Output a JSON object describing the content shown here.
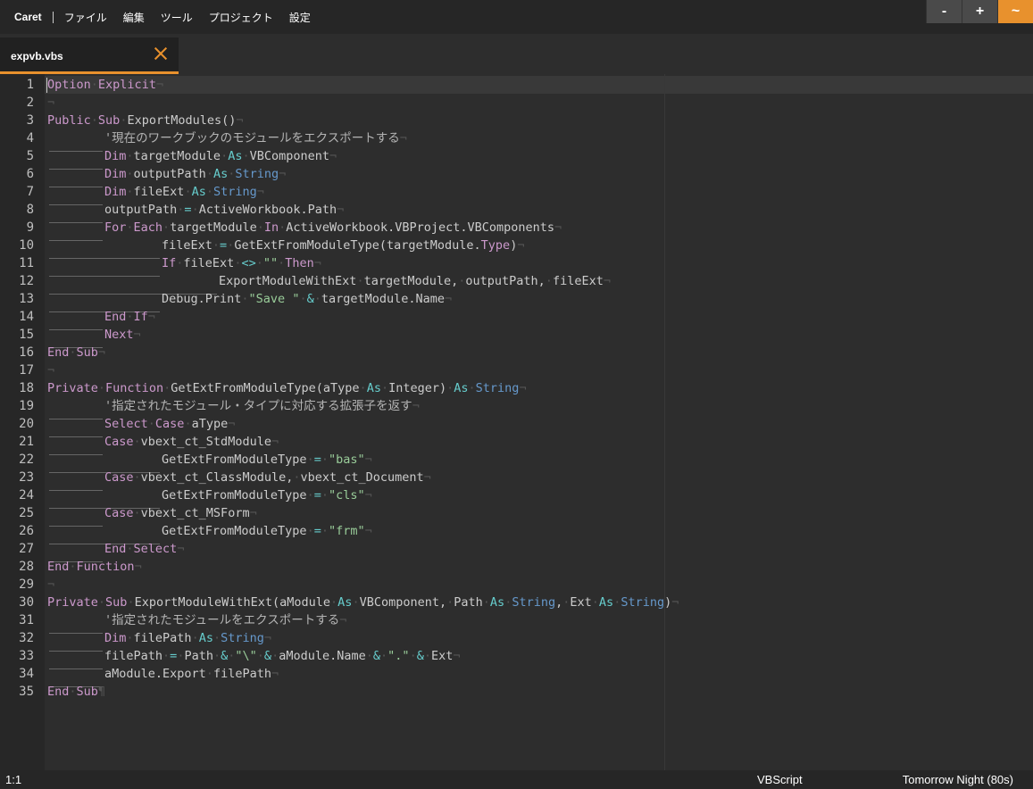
{
  "app": {
    "name": "Caret"
  },
  "menu": [
    "ファイル",
    "編集",
    "ツール",
    "プロジェクト",
    "設定"
  ],
  "window_controls": [
    "-",
    "+",
    "~"
  ],
  "tab": {
    "title": "expvb.vbs"
  },
  "colors": {
    "accent": "#e8912d",
    "background": "#2d2d2d",
    "keyword": "#cc99cc",
    "type": "#6699cc",
    "string": "#99cc99",
    "operator": "#66cccc"
  },
  "editor": {
    "lines": [
      [
        {
          "t": "Option",
          "c": "kw"
        },
        {
          "t": "·",
          "c": "eol"
        },
        {
          "t": "Explicit",
          "c": "kw"
        },
        {
          "t": "¬",
          "c": "eol"
        }
      ],
      [
        {
          "t": "¬",
          "c": "eol"
        }
      ],
      [
        {
          "t": "Public",
          "c": "kw"
        },
        {
          "t": "·",
          "c": "eol"
        },
        {
          "t": "Sub",
          "c": "kw"
        },
        {
          "t": "·",
          "c": "eol"
        },
        {
          "t": "ExportModules()"
        },
        {
          "t": "¬",
          "c": "eol"
        }
      ],
      [
        {
          "i": 1
        },
        {
          "t": "'現在のワークブックのモジュールをエクスポートする",
          "c": "cm"
        },
        {
          "t": "¬",
          "c": "eol"
        }
      ],
      [
        {
          "i": 1
        },
        {
          "t": "Dim",
          "c": "kw"
        },
        {
          "t": "·",
          "c": "eol"
        },
        {
          "t": "targetModule"
        },
        {
          "t": "·",
          "c": "eol"
        },
        {
          "t": "As",
          "c": "op"
        },
        {
          "t": "·",
          "c": "eol"
        },
        {
          "t": "VBComponent"
        },
        {
          "t": "¬",
          "c": "eol"
        }
      ],
      [
        {
          "i": 1
        },
        {
          "t": "Dim",
          "c": "kw"
        },
        {
          "t": "·",
          "c": "eol"
        },
        {
          "t": "outputPath"
        },
        {
          "t": "·",
          "c": "eol"
        },
        {
          "t": "As",
          "c": "op"
        },
        {
          "t": "·",
          "c": "eol"
        },
        {
          "t": "String",
          "c": "ty"
        },
        {
          "t": "¬",
          "c": "eol"
        }
      ],
      [
        {
          "i": 1
        },
        {
          "t": "Dim",
          "c": "kw"
        },
        {
          "t": "·",
          "c": "eol"
        },
        {
          "t": "fileExt"
        },
        {
          "t": "·",
          "c": "eol"
        },
        {
          "t": "As",
          "c": "op"
        },
        {
          "t": "·",
          "c": "eol"
        },
        {
          "t": "String",
          "c": "ty"
        },
        {
          "t": "¬",
          "c": "eol"
        }
      ],
      [
        {
          "i": 1
        },
        {
          "t": "outputPath"
        },
        {
          "t": "·",
          "c": "eol"
        },
        {
          "t": "=",
          "c": "op"
        },
        {
          "t": "·",
          "c": "eol"
        },
        {
          "t": "ActiveWorkbook.Path"
        },
        {
          "t": "¬",
          "c": "eol"
        }
      ],
      [
        {
          "i": 1
        },
        {
          "t": "For",
          "c": "kw"
        },
        {
          "t": "·",
          "c": "eol"
        },
        {
          "t": "Each",
          "c": "kw"
        },
        {
          "t": "·",
          "c": "eol"
        },
        {
          "t": "targetModule"
        },
        {
          "t": "·",
          "c": "eol"
        },
        {
          "t": "In",
          "c": "kw"
        },
        {
          "t": "·",
          "c": "eol"
        },
        {
          "t": "ActiveWorkbook.VBProject.VBComponents"
        },
        {
          "t": "¬",
          "c": "eol"
        }
      ],
      [
        {
          "i": 2
        },
        {
          "t": "fileExt"
        },
        {
          "t": "·",
          "c": "eol"
        },
        {
          "t": "=",
          "c": "op"
        },
        {
          "t": "·",
          "c": "eol"
        },
        {
          "t": "GetExtFromModuleType(targetModule."
        },
        {
          "t": "Type",
          "c": "kw"
        },
        {
          "t": ")"
        },
        {
          "t": "¬",
          "c": "eol"
        }
      ],
      [
        {
          "i": 2
        },
        {
          "t": "If",
          "c": "kw"
        },
        {
          "t": "·",
          "c": "eol"
        },
        {
          "t": "fileExt"
        },
        {
          "t": "·",
          "c": "eol"
        },
        {
          "t": "<>",
          "c": "op"
        },
        {
          "t": "·",
          "c": "eol"
        },
        {
          "t": "\"\"",
          "c": "str"
        },
        {
          "t": "·",
          "c": "eol"
        },
        {
          "t": "Then",
          "c": "kw"
        },
        {
          "t": "¬",
          "c": "eol"
        }
      ],
      [
        {
          "i": 3
        },
        {
          "t": "ExportModuleWithExt"
        },
        {
          "t": "·",
          "c": "eol"
        },
        {
          "t": "targetModule,"
        },
        {
          "t": "·",
          "c": "eol"
        },
        {
          "t": "outputPath,"
        },
        {
          "t": "·",
          "c": "eol"
        },
        {
          "t": "fileExt"
        },
        {
          "t": "¬",
          "c": "eol"
        }
      ],
      [
        {
          "i": 2
        },
        {
          "t": "Debug.Print"
        },
        {
          "t": "·",
          "c": "eol"
        },
        {
          "t": "\"Save \"",
          "c": "str"
        },
        {
          "t": "·",
          "c": "eol"
        },
        {
          "t": "&",
          "c": "op"
        },
        {
          "t": "·",
          "c": "eol"
        },
        {
          "t": "targetModule.Name"
        },
        {
          "t": "¬",
          "c": "eol"
        }
      ],
      [
        {
          "i": 1
        },
        {
          "t": "End",
          "c": "kw"
        },
        {
          "t": "·",
          "c": "eol"
        },
        {
          "t": "If",
          "c": "kw"
        },
        {
          "t": "¬",
          "c": "eol"
        }
      ],
      [
        {
          "i": 1
        },
        {
          "t": "Next",
          "c": "kw"
        },
        {
          "t": "¬",
          "c": "eol"
        }
      ],
      [
        {
          "t": "End",
          "c": "kw"
        },
        {
          "t": "·",
          "c": "eol"
        },
        {
          "t": "Sub",
          "c": "kw"
        },
        {
          "t": "¬",
          "c": "eol"
        }
      ],
      [
        {
          "t": "¬",
          "c": "eol"
        }
      ],
      [
        {
          "t": "Private",
          "c": "kw"
        },
        {
          "t": "·",
          "c": "eol"
        },
        {
          "t": "Function",
          "c": "kw"
        },
        {
          "t": "·",
          "c": "eol"
        },
        {
          "t": "GetExtFromModuleType(aType"
        },
        {
          "t": "·",
          "c": "eol"
        },
        {
          "t": "As",
          "c": "op"
        },
        {
          "t": "·",
          "c": "eol"
        },
        {
          "t": "Integer)"
        },
        {
          "t": "·",
          "c": "eol"
        },
        {
          "t": "As",
          "c": "op"
        },
        {
          "t": "·",
          "c": "eol"
        },
        {
          "t": "String",
          "c": "ty"
        },
        {
          "t": "¬",
          "c": "eol"
        }
      ],
      [
        {
          "i": 1
        },
        {
          "t": "'指定されたモジュール・タイプに対応する拡張子を返す",
          "c": "cm"
        },
        {
          "t": "¬",
          "c": "eol"
        }
      ],
      [
        {
          "i": 1
        },
        {
          "t": "Select",
          "c": "kw"
        },
        {
          "t": "·",
          "c": "eol"
        },
        {
          "t": "Case",
          "c": "kw"
        },
        {
          "t": "·",
          "c": "eol"
        },
        {
          "t": "aType"
        },
        {
          "t": "¬",
          "c": "eol"
        }
      ],
      [
        {
          "i": 1
        },
        {
          "t": "Case",
          "c": "kw"
        },
        {
          "t": "·",
          "c": "eol"
        },
        {
          "t": "vbext_ct_StdModule"
        },
        {
          "t": "¬",
          "c": "eol"
        }
      ],
      [
        {
          "i": 2
        },
        {
          "t": "GetExtFromModuleType"
        },
        {
          "t": "·",
          "c": "eol"
        },
        {
          "t": "=",
          "c": "op"
        },
        {
          "t": "·",
          "c": "eol"
        },
        {
          "t": "\"bas\"",
          "c": "str"
        },
        {
          "t": "¬",
          "c": "eol"
        }
      ],
      [
        {
          "i": 1
        },
        {
          "t": "Case",
          "c": "kw"
        },
        {
          "t": "·",
          "c": "eol"
        },
        {
          "t": "vbext_ct_ClassModule,"
        },
        {
          "t": "·",
          "c": "eol"
        },
        {
          "t": "vbext_ct_Document"
        },
        {
          "t": "¬",
          "c": "eol"
        }
      ],
      [
        {
          "i": 2
        },
        {
          "t": "GetExtFromModuleType"
        },
        {
          "t": "·",
          "c": "eol"
        },
        {
          "t": "=",
          "c": "op"
        },
        {
          "t": "·",
          "c": "eol"
        },
        {
          "t": "\"cls\"",
          "c": "str"
        },
        {
          "t": "¬",
          "c": "eol"
        }
      ],
      [
        {
          "i": 1
        },
        {
          "t": "Case",
          "c": "kw"
        },
        {
          "t": "·",
          "c": "eol"
        },
        {
          "t": "vbext_ct_MSForm"
        },
        {
          "t": "¬",
          "c": "eol"
        }
      ],
      [
        {
          "i": 2
        },
        {
          "t": "GetExtFromModuleType"
        },
        {
          "t": "·",
          "c": "eol"
        },
        {
          "t": "=",
          "c": "op"
        },
        {
          "t": "·",
          "c": "eol"
        },
        {
          "t": "\"frm\"",
          "c": "str"
        },
        {
          "t": "¬",
          "c": "eol"
        }
      ],
      [
        {
          "i": 1
        },
        {
          "t": "End",
          "c": "kw"
        },
        {
          "t": "·",
          "c": "eol"
        },
        {
          "t": "Select",
          "c": "kw"
        },
        {
          "t": "¬",
          "c": "eol"
        }
      ],
      [
        {
          "t": "End",
          "c": "kw"
        },
        {
          "t": "·",
          "c": "eol"
        },
        {
          "t": "Function",
          "c": "kw"
        },
        {
          "t": "¬",
          "c": "eol"
        }
      ],
      [
        {
          "t": "¬",
          "c": "eol"
        }
      ],
      [
        {
          "t": "Private",
          "c": "kw"
        },
        {
          "t": "·",
          "c": "eol"
        },
        {
          "t": "Sub",
          "c": "kw"
        },
        {
          "t": "·",
          "c": "eol"
        },
        {
          "t": "ExportModuleWithExt(aModule"
        },
        {
          "t": "·",
          "c": "eol"
        },
        {
          "t": "As",
          "c": "op"
        },
        {
          "t": "·",
          "c": "eol"
        },
        {
          "t": "VBComponent,"
        },
        {
          "t": "·",
          "c": "eol"
        },
        {
          "t": "Path"
        },
        {
          "t": "·",
          "c": "eol"
        },
        {
          "t": "As",
          "c": "op"
        },
        {
          "t": "·",
          "c": "eol"
        },
        {
          "t": "String",
          "c": "ty"
        },
        {
          "t": ","
        },
        {
          "t": "·",
          "c": "eol"
        },
        {
          "t": "Ext"
        },
        {
          "t": "·",
          "c": "eol"
        },
        {
          "t": "As",
          "c": "op"
        },
        {
          "t": "·",
          "c": "eol"
        },
        {
          "t": "String",
          "c": "ty"
        },
        {
          "t": ")"
        },
        {
          "t": "¬",
          "c": "eol"
        }
      ],
      [
        {
          "i": 1
        },
        {
          "t": "'指定されたモジュールをエクスポートする",
          "c": "cm"
        },
        {
          "t": "¬",
          "c": "eol"
        }
      ],
      [
        {
          "i": 1
        },
        {
          "t": "Dim",
          "c": "kw"
        },
        {
          "t": "·",
          "c": "eol"
        },
        {
          "t": "filePath"
        },
        {
          "t": "·",
          "c": "eol"
        },
        {
          "t": "As",
          "c": "op"
        },
        {
          "t": "·",
          "c": "eol"
        },
        {
          "t": "String",
          "c": "ty"
        },
        {
          "t": "¬",
          "c": "eol"
        }
      ],
      [
        {
          "i": 1
        },
        {
          "t": "filePath"
        },
        {
          "t": "·",
          "c": "eol"
        },
        {
          "t": "=",
          "c": "op"
        },
        {
          "t": "·",
          "c": "eol"
        },
        {
          "t": "Path"
        },
        {
          "t": "·",
          "c": "eol"
        },
        {
          "t": "&",
          "c": "op"
        },
        {
          "t": "·",
          "c": "eol"
        },
        {
          "t": "\"\\\"",
          "c": "str"
        },
        {
          "t": "·",
          "c": "eol"
        },
        {
          "t": "&",
          "c": "op"
        },
        {
          "t": "·",
          "c": "eol"
        },
        {
          "t": "aModule.Name"
        },
        {
          "t": "·",
          "c": "eol"
        },
        {
          "t": "&",
          "c": "op"
        },
        {
          "t": "·",
          "c": "eol"
        },
        {
          "t": "\".\"",
          "c": "str"
        },
        {
          "t": "·",
          "c": "eol"
        },
        {
          "t": "&",
          "c": "op"
        },
        {
          "t": "·",
          "c": "eol"
        },
        {
          "t": "Ext"
        },
        {
          "t": "¬",
          "c": "eol"
        }
      ],
      [
        {
          "i": 1
        },
        {
          "t": "aModule.Export"
        },
        {
          "t": "·",
          "c": "eol"
        },
        {
          "t": "filePath"
        },
        {
          "t": "¬",
          "c": "eol"
        }
      ],
      [
        {
          "t": "End",
          "c": "kw"
        },
        {
          "t": "·",
          "c": "eol"
        },
        {
          "t": "Sub",
          "c": "kw"
        },
        {
          "t": "¶",
          "c": "eol"
        }
      ]
    ]
  },
  "status": {
    "position": "1:1",
    "language": "VBScript",
    "theme": "Tomorrow Night (80s)"
  }
}
